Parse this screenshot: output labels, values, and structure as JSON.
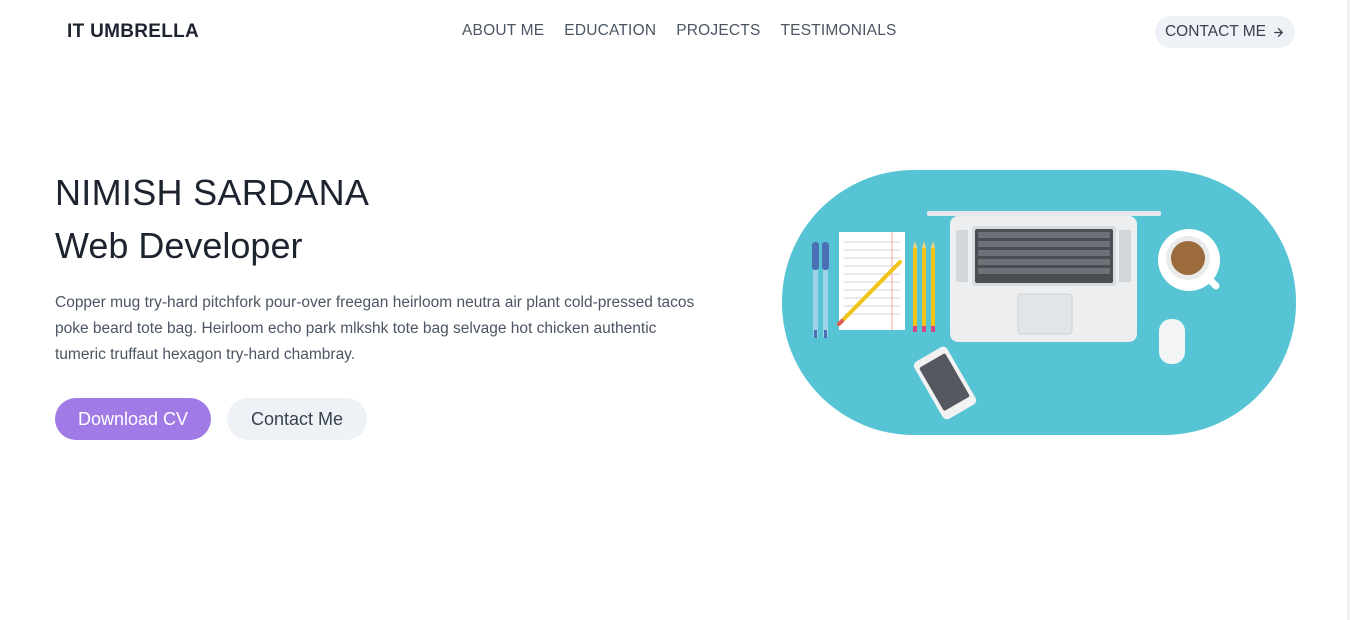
{
  "header": {
    "brand": "IT UMBRELLA",
    "nav": [
      "ABOUT ME",
      "EDUCATION",
      "PROJECTS",
      "TESTIMONIALS"
    ],
    "contact_label": "CONTACT ME",
    "contact_icon": "arrow-right-icon"
  },
  "hero": {
    "name": "NIMISH SARDANA",
    "role": "Web Developer",
    "description": "Copper mug try-hard pitchfork pour-over freegan heirloom neutra air plant cold-pressed tacos poke beard tote bag. Heirloom echo park mlkshk tote bag selvage hot chicken authentic tumeric truffaut hexagon try-hard chambray.",
    "primary_button": "Download CV",
    "secondary_button": "Contact Me"
  },
  "illustration": {
    "description_icon": "desk-illustration-icon",
    "background_color": "#56c4d4"
  },
  "colors": {
    "primary": "#a07be6",
    "secondary_bg": "#eef1f5",
    "text_dark": "#1e2330",
    "text_muted": "#4b5563"
  }
}
